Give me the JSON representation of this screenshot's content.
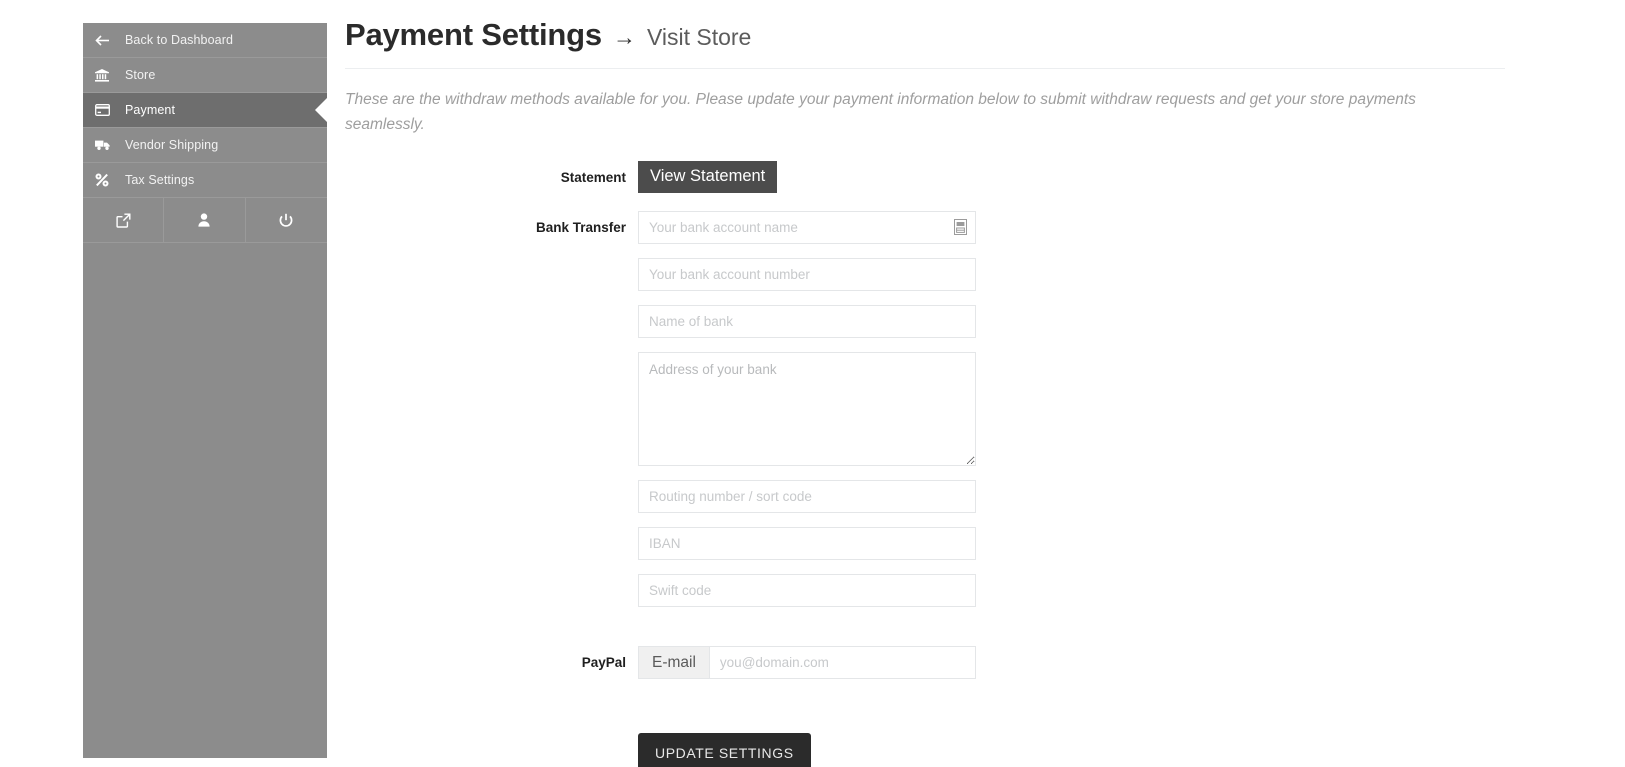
{
  "sidebar": {
    "items": [
      {
        "label": "Back to Dashboard",
        "icon": "arrow-left-icon",
        "active": false
      },
      {
        "label": "Store",
        "icon": "bank-icon",
        "active": false
      },
      {
        "label": "Payment",
        "icon": "credit-card-icon",
        "active": true
      },
      {
        "label": "Vendor Shipping",
        "icon": "truck-icon",
        "active": false
      },
      {
        "label": "Tax Settings",
        "icon": "percent-icon",
        "active": false
      }
    ],
    "tools": [
      {
        "name": "external-link-icon"
      },
      {
        "name": "user-icon"
      },
      {
        "name": "power-icon"
      }
    ]
  },
  "header": {
    "title": "Payment Settings",
    "arrow": "→",
    "visit_store": "Visit Store"
  },
  "lead": "These are the withdraw methods available for you. Please update your payment information below to submit withdraw requests and get your store payments seamlessly.",
  "form": {
    "statement": {
      "label": "Statement",
      "button_label": "View Statement"
    },
    "bank_transfer": {
      "label": "Bank Transfer",
      "fields": [
        {
          "name": "account-name",
          "placeholder": "Your bank account name",
          "value": "",
          "type": "text",
          "icon": "autofill-save-icon"
        },
        {
          "name": "account-number",
          "placeholder": "Your bank account number",
          "value": "",
          "type": "text"
        },
        {
          "name": "bank-name",
          "placeholder": "Name of bank",
          "value": "",
          "type": "text"
        },
        {
          "name": "bank-address",
          "placeholder": "Address of your bank",
          "value": "",
          "type": "textarea"
        },
        {
          "name": "routing-number",
          "placeholder": "Routing number / sort code",
          "value": "",
          "type": "text"
        },
        {
          "name": "iban",
          "placeholder": "IBAN",
          "value": "",
          "type": "text"
        },
        {
          "name": "swift-code",
          "placeholder": "Swift code",
          "value": "",
          "type": "text"
        }
      ]
    },
    "paypal": {
      "label": "PayPal",
      "addon": "E-mail",
      "placeholder": "you@domain.com",
      "value": ""
    },
    "submit_label": "UPDATE SETTINGS"
  },
  "colors": {
    "sidebar_bg": "#8c8c8c",
    "sidebar_active_bg": "#6e6e6e",
    "statement_btn_bg": "#4c4c4c",
    "submit_btn_bg": "#2b2b2b",
    "input_border": "#e4e6e8"
  }
}
